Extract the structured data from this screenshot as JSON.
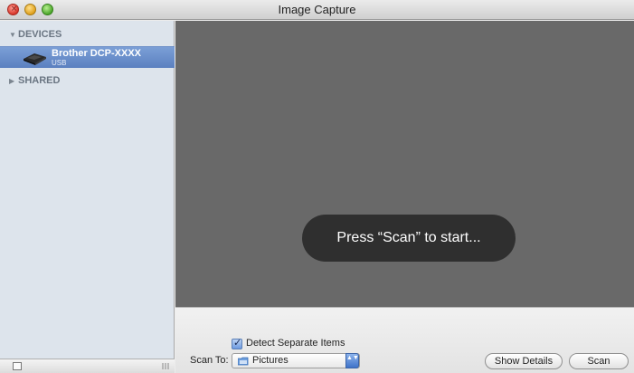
{
  "window": {
    "title": "Image Capture",
    "controls": {
      "close_glyph": "×",
      "minimize_glyph": "",
      "zoom_glyph": ""
    }
  },
  "sidebar": {
    "devices_header": "DEVICES",
    "devices_arrow": "▼",
    "selected_device": {
      "name": "Brother DCP-XXXX",
      "connection": "USB"
    },
    "shared_header": "SHARED",
    "shared_arrow": "▶"
  },
  "preview": {
    "hud_message": "Press “Scan” to start..."
  },
  "controls": {
    "detect_separate_items": {
      "label": "Detect Separate Items",
      "checked": true,
      "mark": "✓"
    },
    "scan_to": {
      "label": "Scan To:",
      "selected": "Pictures",
      "arrows": "▲▼"
    },
    "show_details_label": "Show Details",
    "scan_label": "Scan"
  },
  "colors": {
    "selection": "#6a8fcc",
    "preview_background": "#696969",
    "hud_background": "#2f2f2f",
    "sidebar_background": "#dde4ec"
  }
}
